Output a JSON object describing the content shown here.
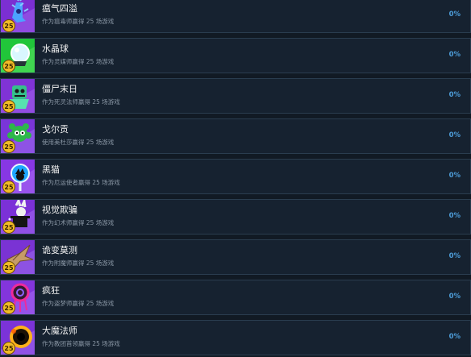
{
  "achievements": [
    {
      "title": "瘟气四溢",
      "desc": "作为瘟毒师赢得 25 场游戏",
      "percent": "0%",
      "level": "25",
      "icon": "plague-icon",
      "bg": "#7b2fd2",
      "accent": "#52a6ff"
    },
    {
      "title": "水晶球",
      "desc": "作为灵媒师赢得 25 场游戏",
      "percent": "0%",
      "level": "25",
      "icon": "crystal-ball-icon",
      "bg": "#21c63a",
      "accent": "#d9f7ff"
    },
    {
      "title": "僵尸末日",
      "desc": "作为死灵法师赢得 25 场游戏",
      "percent": "0%",
      "level": "25",
      "icon": "zombie-icon",
      "bg": "#8033d6",
      "accent": "#45d39a"
    },
    {
      "title": "戈尔贡",
      "desc": "使用美杜莎赢得 25 场游戏",
      "percent": "0%",
      "level": "25",
      "icon": "gorgon-icon",
      "bg": "#7a35d8",
      "accent": "#2db84a"
    },
    {
      "title": "黑猫",
      "desc": "作为厄运使者赢得 25 场游戏",
      "percent": "0%",
      "level": "25",
      "icon": "black-cat-mirror-icon",
      "bg": "#8737e4",
      "accent": "#1ea6ff"
    },
    {
      "title": "视觉欺骗",
      "desc": "作为幻术师赢得 25 场游戏",
      "percent": "0%",
      "level": "25",
      "icon": "magic-hat-rabbit-icon",
      "bg": "#7b31d7",
      "accent": "#f1f1f1"
    },
    {
      "title": "诡变莫测",
      "desc": "作为附魔师赢得 25 场游戏",
      "percent": "0%",
      "level": "25",
      "icon": "paper-crane-icon",
      "bg": "#7a33d4",
      "accent": "#c69b67"
    },
    {
      "title": "疯狂",
      "desc": "作为盗梦师赢得 25 场游戏",
      "percent": "0%",
      "level": "25",
      "icon": "dreamcatcher-icon",
      "bg": "#8335dc",
      "accent": "#ef2a9c"
    },
    {
      "title": "大魔法师",
      "desc": "作为教团首领赢得 25 场游戏",
      "percent": "0%",
      "level": "25",
      "icon": "dark-portal-icon",
      "bg": "#7b33d8",
      "accent": "#ffb21a"
    }
  ]
}
